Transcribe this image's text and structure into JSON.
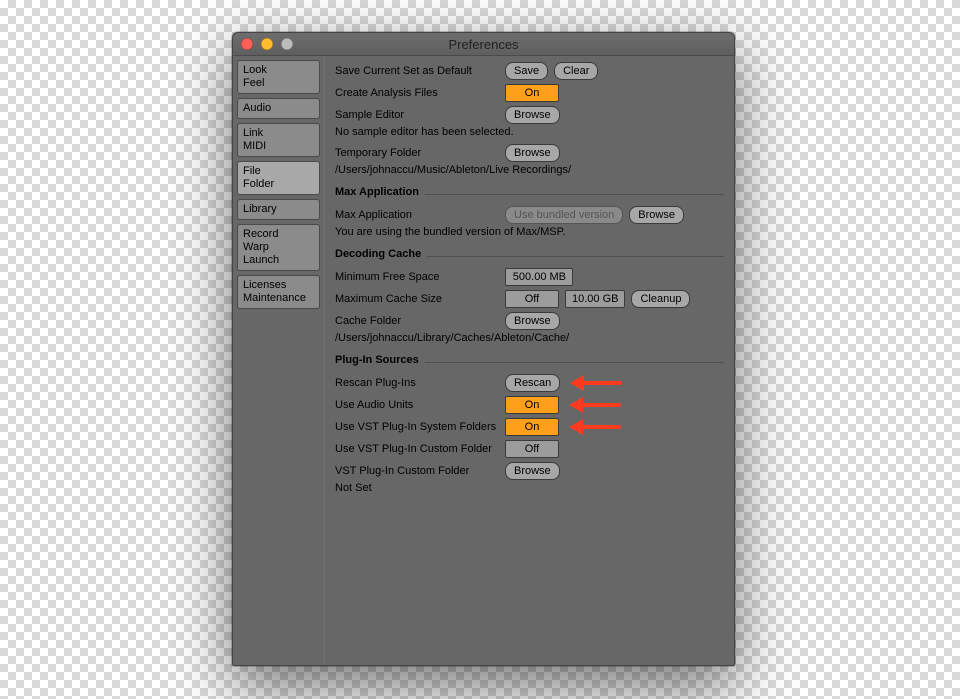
{
  "window": {
    "title": "Preferences"
  },
  "traffic": {
    "close": "red",
    "min": "yellow",
    "zoom": "gray"
  },
  "sidebar": {
    "tabs": [
      {
        "id": "look-feel",
        "label": "Look\nFeel",
        "selected": false
      },
      {
        "id": "audio",
        "label": "Audio",
        "selected": false
      },
      {
        "id": "link-midi",
        "label": "Link\nMIDI",
        "selected": false
      },
      {
        "id": "file-folder",
        "label": "File\nFolder",
        "selected": true
      },
      {
        "id": "library",
        "label": "Library",
        "selected": false
      },
      {
        "id": "record-warp",
        "label": "Record\nWarp\nLaunch",
        "selected": false
      },
      {
        "id": "licenses",
        "label": "Licenses\nMaintenance",
        "selected": false
      }
    ]
  },
  "file_folder": {
    "save_default": {
      "label": "Save Current Set as Default",
      "save_btn": "Save",
      "clear_btn": "Clear"
    },
    "create_analysis": {
      "label": "Create Analysis Files",
      "state": "On"
    },
    "sample_editor": {
      "label": "Sample Editor",
      "browse_btn": "Browse",
      "status": "No sample editor has been selected."
    },
    "temp_folder": {
      "label": "Temporary Folder",
      "browse_btn": "Browse",
      "path": "/Users/johnaccu/Music/Ableton/Live Recordings/"
    },
    "max_section": "Max Application",
    "max_app": {
      "label": "Max Application",
      "dim_btn": "Use bundled version",
      "browse_btn": "Browse",
      "status": "You are using the bundled version of Max/MSP."
    },
    "cache_section": "Decoding Cache",
    "min_free": {
      "label": "Minimum Free Space",
      "value": "500.00 MB"
    },
    "max_cache": {
      "label": "Maximum Cache Size",
      "state": "Off",
      "value": "10.00 GB",
      "cleanup_btn": "Cleanup"
    },
    "cache_folder": {
      "label": "Cache Folder",
      "browse_btn": "Browse",
      "path": "/Users/johnaccu/Library/Caches/Ableton/Cache/"
    },
    "plugins_section": "Plug-In Sources",
    "rescan": {
      "label": "Rescan Plug-Ins",
      "btn": "Rescan"
    },
    "use_au": {
      "label": "Use Audio Units",
      "state": "On"
    },
    "use_vst_sys": {
      "label": "Use VST Plug-In System Folders",
      "state": "On"
    },
    "use_vst_custom": {
      "label": "Use VST Plug-In Custom Folder",
      "state": "Off"
    },
    "vst_custom_folder": {
      "label": "VST Plug-In Custom Folder",
      "browse_btn": "Browse",
      "status": "Not Set"
    }
  },
  "annotations": {
    "arrows_to": [
      "rescan",
      "use_au",
      "use_vst_sys"
    ]
  }
}
